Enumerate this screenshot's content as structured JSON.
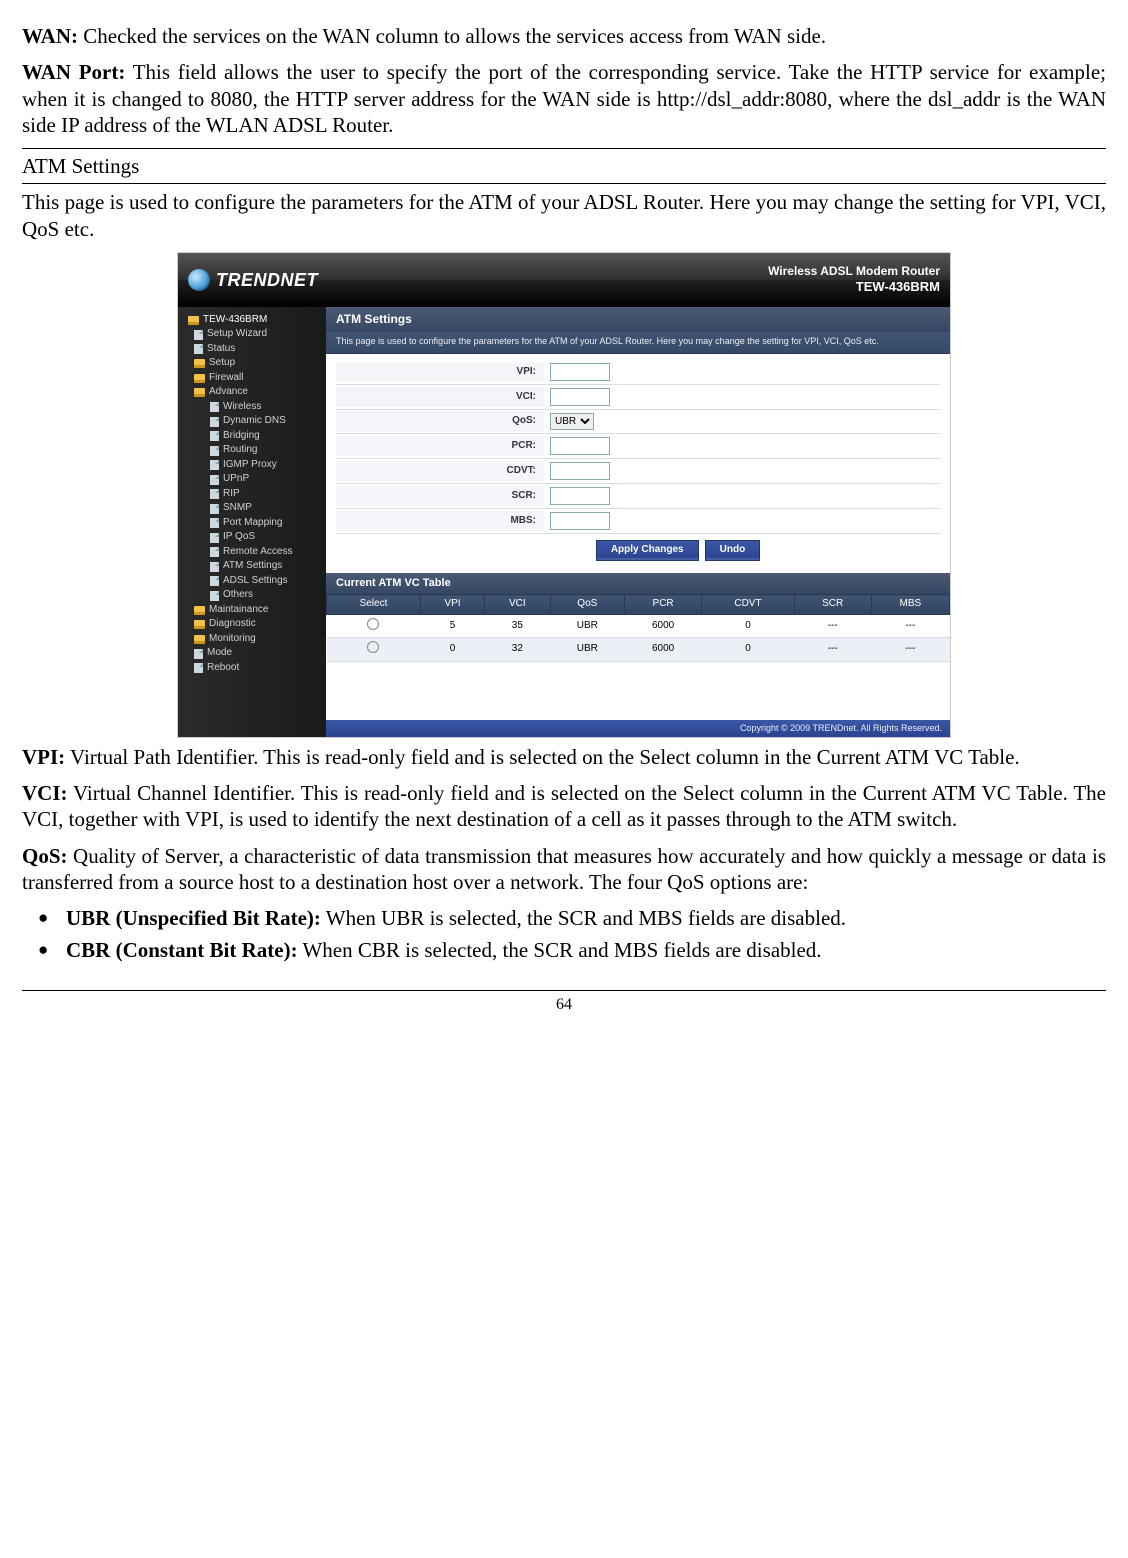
{
  "paragraphs": {
    "wan_label": "WAN:",
    "wan_text": " Checked the services on the WAN column to allows the services access from WAN side.",
    "wanport_label": "WAN Port:",
    "wanport_text": " This field allows the user to specify the port of the corresponding service. Take the HTTP service for example; when it is changed to 8080, the HTTP server address for the WAN side is http://dsl_addr:8080, where the dsl_addr is the WAN side IP address of the WLAN ADSL Router.",
    "atm_heading": "ATM Settings",
    "atm_intro": "This page is used to configure the parameters for the ATM of your ADSL Router. Here you may change the setting for VPI, VCI, QoS etc.",
    "vpi_label": "VPI:",
    "vpi_text": " Virtual Path Identifier. This is read-only field and is selected on the Select column in the Current ATM VC Table.",
    "vci_label": "VCI:",
    "vci_text": " Virtual Channel Identifier. This is read-only field and is selected on the Select column in the Current ATM VC Table. The VCI, together with VPI, is used to identify the next destination of a cell as it passes through to the ATM switch.",
    "qos_label": "QoS:",
    "qos_text": " Quality of Server, a characteristic of data transmission that measures how accurately and how quickly a message or data is transferred from a source host to a destination host over a network. The four QoS options are:",
    "ubr_label": "UBR (Unspecified Bit Rate):",
    "ubr_text": " When UBR is selected, the SCR and MBS fields are disabled.",
    "cbr_label": "CBR (Constant Bit Rate):",
    "cbr_text": " When CBR is selected, the SCR and MBS fields are disabled."
  },
  "router": {
    "brand": "TRENDNET",
    "header_line1": "Wireless ADSL Modem Router",
    "header_line2": "TEW-436BRM",
    "sidebar": {
      "root": "TEW-436BRM",
      "items_l2": [
        "Setup Wizard",
        "Status",
        "Setup",
        "Firewall",
        "Advance"
      ],
      "items_advance": [
        "Wireless",
        "Dynamic DNS",
        "Bridging",
        "Routing",
        "IGMP Proxy",
        "UPnP",
        "RIP",
        "SNMP",
        "Port Mapping",
        "IP QoS",
        "Remote Access",
        "ATM Settings",
        "ADSL Settings",
        "Others"
      ],
      "items_l2b": [
        "Maintainance",
        "Diagnostic",
        "Monitoring",
        "Mode",
        "Reboot"
      ]
    },
    "panel": {
      "title": "ATM Settings",
      "desc": "This page is used to configure the parameters for the ATM of your ADSL Router. Here you may change the setting for VPI, VCI, QoS etc.",
      "fields": {
        "vpi": "VPI:",
        "vci": "VCI:",
        "qos": "QoS:",
        "qos_value": "UBR",
        "pcr": "PCR:",
        "cdvt": "CDVT:",
        "scr": "SCR:",
        "mbs": "MBS:"
      },
      "buttons": {
        "apply": "Apply Changes",
        "undo": "Undo"
      }
    },
    "table": {
      "title": "Current ATM VC Table",
      "headers": [
        "Select",
        "VPI",
        "VCI",
        "QoS",
        "PCR",
        "CDVT",
        "SCR",
        "MBS"
      ],
      "rows": [
        {
          "vpi": "5",
          "vci": "35",
          "qos": "UBR",
          "pcr": "6000",
          "cdvt": "0",
          "scr": "---",
          "mbs": "---"
        },
        {
          "vpi": "0",
          "vci": "32",
          "qos": "UBR",
          "pcr": "6000",
          "cdvt": "0",
          "scr": "---",
          "mbs": "---"
        }
      ]
    },
    "footer": "Copyright © 2009 TRENDnet. All Rights Reserved."
  },
  "page_number": "64"
}
